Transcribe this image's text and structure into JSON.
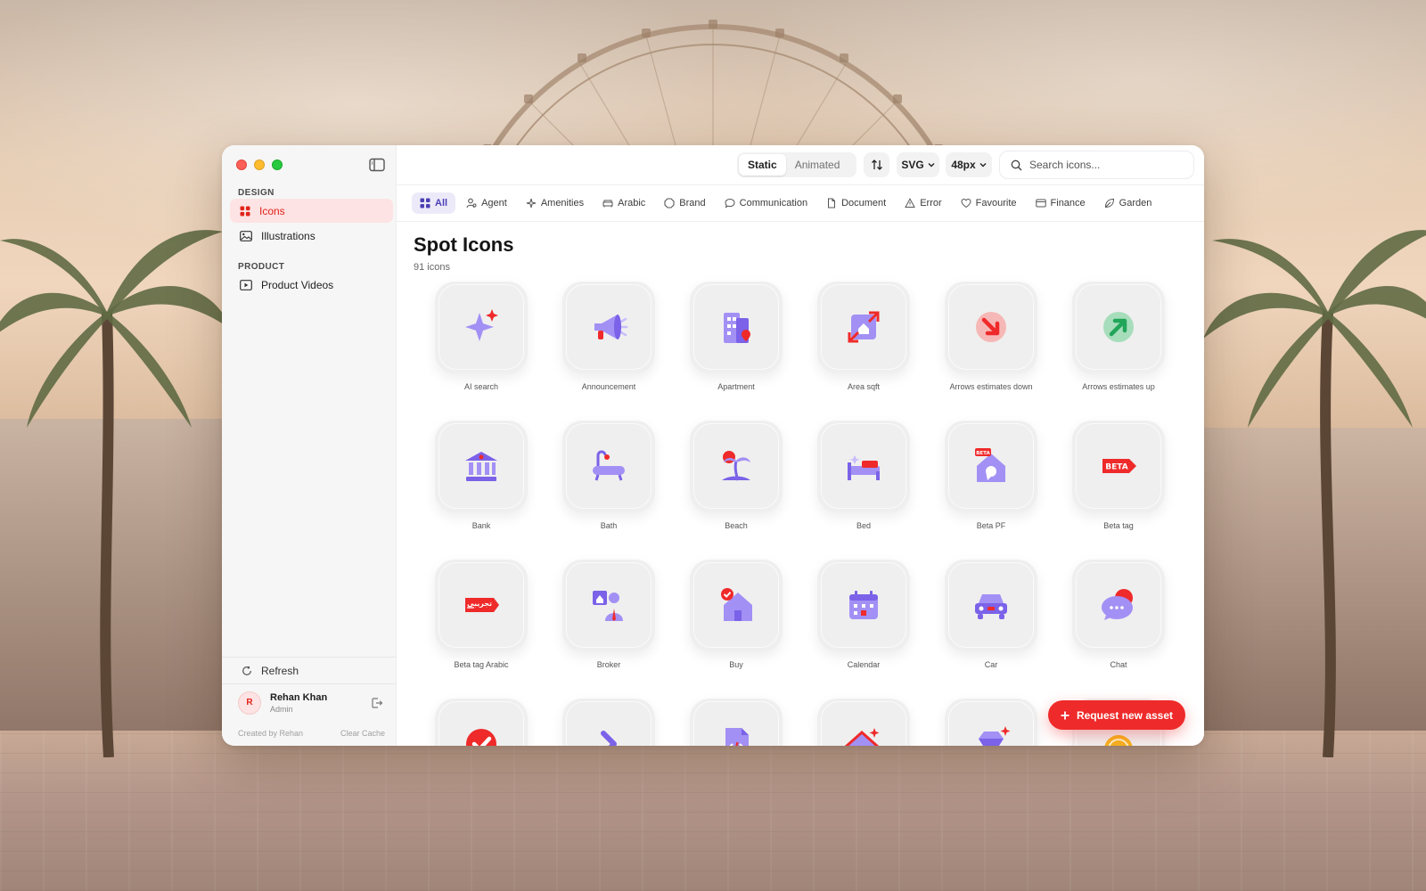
{
  "sidebar": {
    "sections": [
      {
        "label": "DESIGN",
        "items": [
          {
            "label": "Icons",
            "active": true
          },
          {
            "label": "Illustrations",
            "active": false
          }
        ]
      },
      {
        "label": "PRODUCT",
        "items": [
          {
            "label": "Product Videos",
            "active": false
          }
        ]
      }
    ],
    "refresh_label": "Refresh",
    "user": {
      "initial": "R",
      "name": "Rehan Khan",
      "role": "Admin"
    },
    "footer": {
      "credit": "Created by Rehan",
      "clear_cache": "Clear Cache"
    }
  },
  "toolbar": {
    "mode_tabs": [
      {
        "label": "Static",
        "selected": true
      },
      {
        "label": "Animated",
        "selected": false
      }
    ],
    "format": "SVG",
    "size": "48px",
    "search_placeholder": "Search icons..."
  },
  "categories": [
    {
      "label": "All",
      "icon": "grid-icon",
      "selected": true
    },
    {
      "label": "Agent",
      "icon": "person-icon"
    },
    {
      "label": "Amenities",
      "icon": "sparkle-icon"
    },
    {
      "label": "Arabic",
      "icon": "sofa-icon"
    },
    {
      "label": "Brand",
      "icon": "octagon-icon"
    },
    {
      "label": "Communication",
      "icon": "message-icon"
    },
    {
      "label": "Document",
      "icon": "file-icon"
    },
    {
      "label": "Error",
      "icon": "warning-icon"
    },
    {
      "label": "Favourite",
      "icon": "heart-icon"
    },
    {
      "label": "Finance",
      "icon": "card-icon"
    },
    {
      "label": "Garden",
      "icon": "leaf-icon"
    }
  ],
  "page": {
    "title": "Spot Icons",
    "count": "91 icons"
  },
  "icons": [
    {
      "label": "AI search",
      "icon": "ai-sparkle-icon"
    },
    {
      "label": "Announcement",
      "icon": "megaphone-icon"
    },
    {
      "label": "Apartment",
      "icon": "apartment-building-icon"
    },
    {
      "label": "Area sqft",
      "icon": "area-expand-icon"
    },
    {
      "label": "Arrows estimates down",
      "icon": "arrow-down-right-icon"
    },
    {
      "label": "Arrows estimates up",
      "icon": "arrow-up-right-icon"
    },
    {
      "label": "Bank",
      "icon": "bank-icon"
    },
    {
      "label": "Bath",
      "icon": "bathtub-icon"
    },
    {
      "label": "Beach",
      "icon": "palm-island-icon"
    },
    {
      "label": "Bed",
      "icon": "bed-icon"
    },
    {
      "label": "Beta PF",
      "icon": "beta-house-icon",
      "badge": "BETA"
    },
    {
      "label": "Beta tag",
      "icon": "beta-tag-icon",
      "badge": "BETA"
    },
    {
      "label": "Beta tag Arabic",
      "icon": "beta-tag-arabic-icon",
      "badge": "تجريبي"
    },
    {
      "label": "Broker",
      "icon": "broker-icon"
    },
    {
      "label": "Buy",
      "icon": "house-check-icon"
    },
    {
      "label": "Calendar",
      "icon": "calendar-icon"
    },
    {
      "label": "Car",
      "icon": "car-icon"
    },
    {
      "label": "Chat",
      "icon": "chat-bubble-icon"
    },
    {
      "label": "",
      "icon": "check-circle-icon"
    },
    {
      "label": "",
      "icon": "chevron-right-icon"
    },
    {
      "label": "",
      "icon": "code-file-icon"
    },
    {
      "label": "",
      "icon": "house-sparkle-icon"
    },
    {
      "label": "",
      "icon": "diamond-icon"
    },
    {
      "label": "",
      "icon": "coin-icon"
    }
  ],
  "request_button": "Request new asset",
  "colors": {
    "accent_red": "#ef2a2a",
    "active_tab_bg": "#fde3e3",
    "purple": "#7b62e8",
    "chip_selected": "#4b3fb5"
  }
}
